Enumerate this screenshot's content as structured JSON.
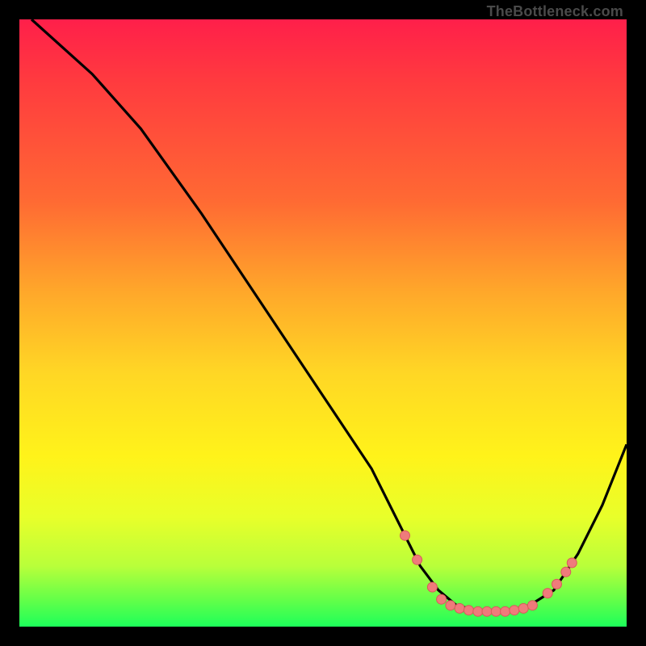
{
  "watermark": "TheBottleneck.com",
  "colors": {
    "border": "#000000",
    "curve": "#000000",
    "marker_fill": "#ef7b7b",
    "marker_stroke": "#d85a5a"
  },
  "chart_data": {
    "type": "line",
    "title": "",
    "xlabel": "",
    "ylabel": "",
    "xlim": [
      0,
      100
    ],
    "ylim": [
      0,
      100
    ],
    "grid": false,
    "curve_note": "y is plotted with 0 at bottom, 100 at top; values estimated from pixels",
    "curve": [
      {
        "x": 2,
        "y": 100
      },
      {
        "x": 12,
        "y": 91
      },
      {
        "x": 20,
        "y": 82
      },
      {
        "x": 30,
        "y": 68
      },
      {
        "x": 40,
        "y": 53
      },
      {
        "x": 50,
        "y": 38
      },
      {
        "x": 58,
        "y": 26
      },
      {
        "x": 63,
        "y": 16
      },
      {
        "x": 66,
        "y": 10
      },
      {
        "x": 69,
        "y": 6
      },
      {
        "x": 72,
        "y": 3.5
      },
      {
        "x": 76,
        "y": 2.5
      },
      {
        "x": 80,
        "y": 2.5
      },
      {
        "x": 84,
        "y": 3.5
      },
      {
        "x": 88,
        "y": 6
      },
      {
        "x": 92,
        "y": 12
      },
      {
        "x": 96,
        "y": 20
      },
      {
        "x": 100,
        "y": 30
      }
    ],
    "markers": [
      {
        "x": 63.5,
        "y": 15
      },
      {
        "x": 65.5,
        "y": 11
      },
      {
        "x": 68,
        "y": 6.5
      },
      {
        "x": 69.5,
        "y": 4.5
      },
      {
        "x": 71,
        "y": 3.5
      },
      {
        "x": 72.5,
        "y": 3
      },
      {
        "x": 74,
        "y": 2.7
      },
      {
        "x": 75.5,
        "y": 2.5
      },
      {
        "x": 77,
        "y": 2.5
      },
      {
        "x": 78.5,
        "y": 2.5
      },
      {
        "x": 80,
        "y": 2.5
      },
      {
        "x": 81.5,
        "y": 2.7
      },
      {
        "x": 83,
        "y": 3
      },
      {
        "x": 84.5,
        "y": 3.5
      },
      {
        "x": 87,
        "y": 5.5
      },
      {
        "x": 88.5,
        "y": 7
      },
      {
        "x": 90,
        "y": 9
      },
      {
        "x": 91,
        "y": 10.5
      }
    ]
  }
}
